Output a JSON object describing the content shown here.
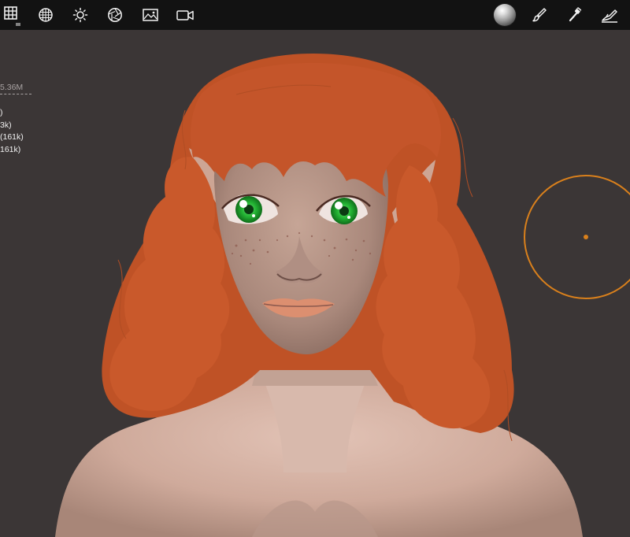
{
  "toolbar": {
    "left_icons": [
      "grid-icon",
      "sphere-wireframe-icon",
      "sun-icon",
      "aperture-icon",
      "image-icon",
      "video-camera-icon"
    ],
    "right_icons": [
      "matcap-sphere-icon",
      "paint-brush-icon",
      "paint-tool-icon",
      "sculpt-tool-icon"
    ]
  },
  "stats": {
    "total": "5.36M",
    "rows": [
      ")",
      "3k)",
      " (161k)",
      "161k)"
    ]
  },
  "colors": {
    "toolbar_bg": "#121212",
    "viewport_bg": "#3b3636",
    "brush_ring": "#d9801c",
    "hair": "#c4552a",
    "skin": "#d6b4a6",
    "iris": "#22b032"
  }
}
